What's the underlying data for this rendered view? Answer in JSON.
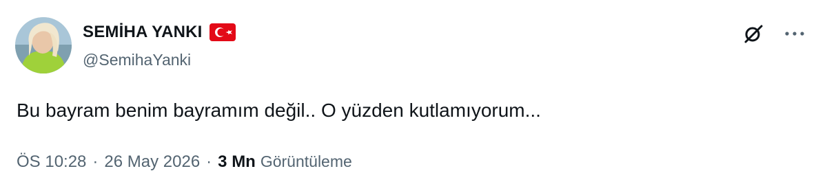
{
  "user": {
    "display_name": "SEMİHA YANKI",
    "handle": "@SemihaYanki",
    "flag_icon": "turkey-flag-icon"
  },
  "header_actions": [
    {
      "icon": "grok-icon"
    },
    {
      "icon": "more-options-icon"
    }
  ],
  "tweet": {
    "text": "Bu bayram benim bayramım değil.. O yüzden kutlamıyorum..."
  },
  "meta": {
    "time": "ÖS 10:28",
    "separator": "·",
    "date": "26 May 2026",
    "views_count": "3 Mn",
    "views_label": "Görüntüleme"
  },
  "colors": {
    "text_primary": "#0f1419",
    "text_secondary": "#536471",
    "flag_red": "#e30a17"
  }
}
